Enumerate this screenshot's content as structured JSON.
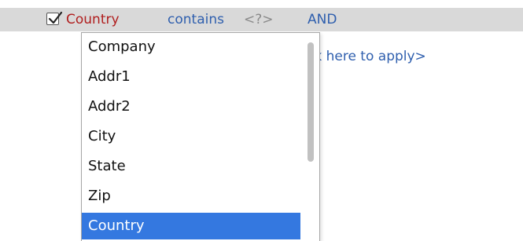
{
  "filter": {
    "checked": true,
    "field": "Country",
    "operator": "contains",
    "value": "<?>",
    "conjunction": "AND"
  },
  "apply_hint": "ck here to apply>",
  "field_dropdown": {
    "items": [
      "Company",
      "Addr1",
      "Addr2",
      "City",
      "State",
      "Zip",
      "Country"
    ],
    "selected": "Country"
  },
  "colors": {
    "field": "#b01e1e",
    "link": "#2f5fae",
    "placeholder": "#8a8a8a",
    "selection": "#3478e0",
    "row_background": "#d9d9d9"
  }
}
